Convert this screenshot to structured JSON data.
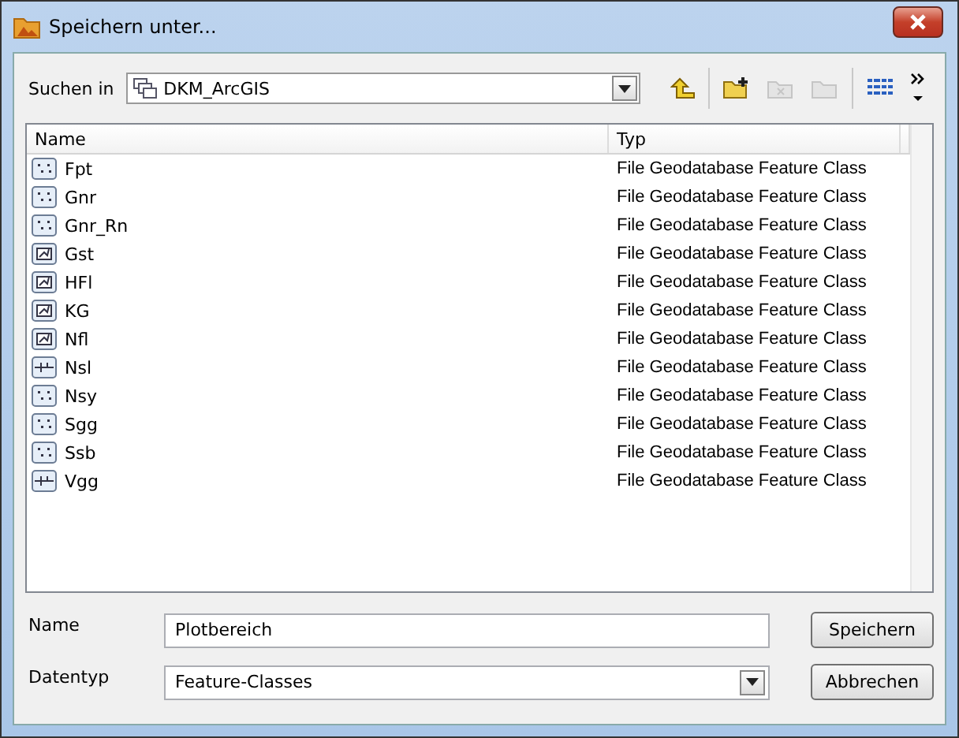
{
  "window": {
    "title": "Speichern unter..."
  },
  "look_in": {
    "label": "Suchen in",
    "value": "DKM_ArcGIS"
  },
  "toolbar": [
    {
      "kind": "up",
      "disabled": false
    },
    {
      "kind": "new-folder",
      "disabled": false
    },
    {
      "kind": "delete",
      "disabled": true
    },
    {
      "kind": "properties",
      "disabled": true
    },
    {
      "kind": "view",
      "disabled": false
    },
    {
      "kind": "overflow",
      "disabled": false
    }
  ],
  "table": {
    "columns": [
      "Name",
      "Typ"
    ],
    "rows": [
      {
        "name": "Fpt",
        "type": "File Geodatabase Feature Class",
        "kind": "point"
      },
      {
        "name": "Gnr",
        "type": "File Geodatabase Feature Class",
        "kind": "point"
      },
      {
        "name": "Gnr_Rn",
        "type": "File Geodatabase Feature Class",
        "kind": "point"
      },
      {
        "name": "Gst",
        "type": "File Geodatabase Feature Class",
        "kind": "polygon"
      },
      {
        "name": "HFl",
        "type": "File Geodatabase Feature Class",
        "kind": "polygon"
      },
      {
        "name": "KG",
        "type": "File Geodatabase Feature Class",
        "kind": "polygon"
      },
      {
        "name": "Nfl",
        "type": "File Geodatabase Feature Class",
        "kind": "polygon"
      },
      {
        "name": "Nsl",
        "type": "File Geodatabase Feature Class",
        "kind": "line"
      },
      {
        "name": "Nsy",
        "type": "File Geodatabase Feature Class",
        "kind": "point"
      },
      {
        "name": "Sgg",
        "type": "File Geodatabase Feature Class",
        "kind": "point"
      },
      {
        "name": "Ssb",
        "type": "File Geodatabase Feature Class",
        "kind": "point"
      },
      {
        "name": "Vgg",
        "type": "File Geodatabase Feature Class",
        "kind": "line"
      }
    ]
  },
  "name_field": {
    "label": "Name",
    "value": "Plotbereich"
  },
  "type_field": {
    "label": "Datentyp",
    "value": "Feature-Classes"
  },
  "buttons": [
    "Speichern",
    "Abbrechen"
  ]
}
